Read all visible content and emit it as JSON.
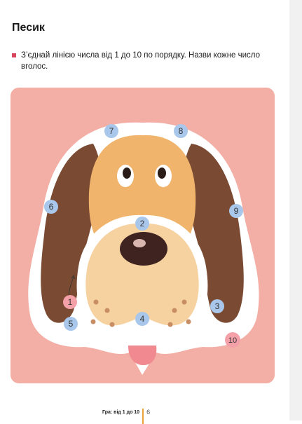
{
  "page": {
    "title": "Песик",
    "instruction": "З’єднай лінією числа від 1 до 10 по порядку. Назви кожне число вголос."
  },
  "puzzle": {
    "dots": [
      "1",
      "2",
      "3",
      "4",
      "5",
      "6",
      "7",
      "8",
      "9",
      "10"
    ]
  },
  "footer": {
    "label": "Гра: від 1 до 10",
    "page_number": "6"
  },
  "colors": {
    "background_panel": "#f3afa5",
    "dog_face": "#f0b46c",
    "dog_ears": "#7a4a33",
    "dog_muzzle": "#f7d2a1",
    "dot_blue": "#a9c7ea",
    "dot_pink": "#f3a0a8",
    "bullet": "#d6455c"
  }
}
